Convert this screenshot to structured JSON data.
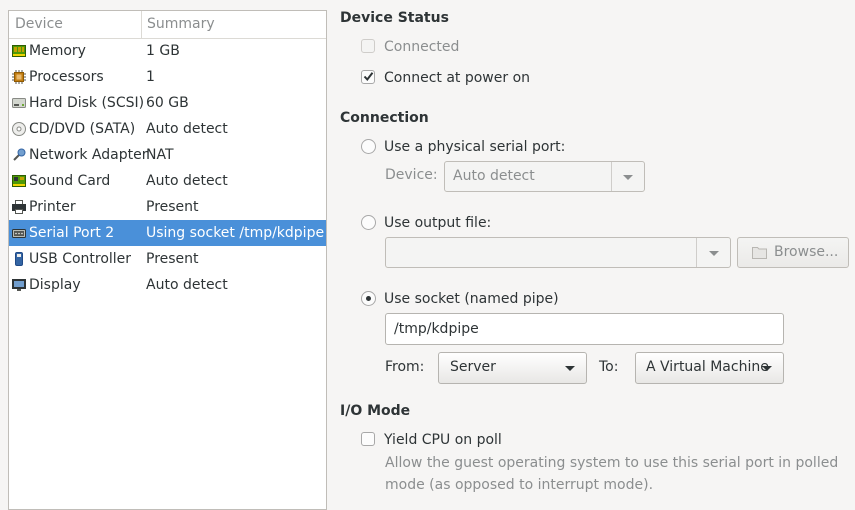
{
  "device_list": {
    "headers": {
      "device": "Device",
      "summary": "Summary"
    },
    "rows": [
      {
        "name": "Memory",
        "summary": "1 GB",
        "icon": "memory-icon",
        "selected": false
      },
      {
        "name": "Processors",
        "summary": "1",
        "icon": "processor-icon",
        "selected": false
      },
      {
        "name": "Hard Disk (SCSI)",
        "summary": "60 GB",
        "icon": "hard-disk-icon",
        "selected": false
      },
      {
        "name": "CD/DVD (SATA)",
        "summary": "Auto detect",
        "icon": "cd-dvd-icon",
        "selected": false
      },
      {
        "name": "Network Adapter",
        "summary": "NAT",
        "icon": "network-adapter-icon",
        "selected": false
      },
      {
        "name": "Sound Card",
        "summary": "Auto detect",
        "icon": "sound-card-icon",
        "selected": false
      },
      {
        "name": "Printer",
        "summary": "Present",
        "icon": "printer-icon",
        "selected": false
      },
      {
        "name": "Serial Port 2",
        "summary": "Using socket /tmp/kdpipe",
        "icon": "serial-port-icon",
        "selected": true
      },
      {
        "name": "USB Controller",
        "summary": "Present",
        "icon": "usb-controller-icon",
        "selected": false
      },
      {
        "name": "Display",
        "summary": "Auto detect",
        "icon": "display-icon",
        "selected": false
      }
    ]
  },
  "device_status": {
    "title": "Device Status",
    "connected": {
      "label": "Connected",
      "checked": false,
      "enabled": false
    },
    "connect_at_power_on": {
      "label": "Connect at power on",
      "checked": true,
      "enabled": true
    }
  },
  "connection": {
    "title": "Connection",
    "physical_port": {
      "label": "Use a physical serial port:",
      "selected": false,
      "device_label": "Device:",
      "device_value": "Auto detect"
    },
    "output_file": {
      "label": "Use output file:",
      "selected": false,
      "file_value": "",
      "browse_label": "Browse..."
    },
    "socket": {
      "label": "Use socket (named pipe)",
      "selected": true,
      "path_value": "/tmp/kdpipe",
      "from_label": "From:",
      "from_value": "Server",
      "to_label": "To:",
      "to_value": "A Virtual Machine"
    }
  },
  "io_mode": {
    "title": "I/O Mode",
    "yield_cpu": {
      "label": "Yield CPU on poll",
      "checked": false
    },
    "help_text": "Allow the guest operating system to use this serial port in polled mode (as opposed to interrupt mode)."
  },
  "colors": {
    "selection": "#4a90d9",
    "window_bg": "#f6f5f4",
    "disabled_text": "#8b8e8f"
  }
}
